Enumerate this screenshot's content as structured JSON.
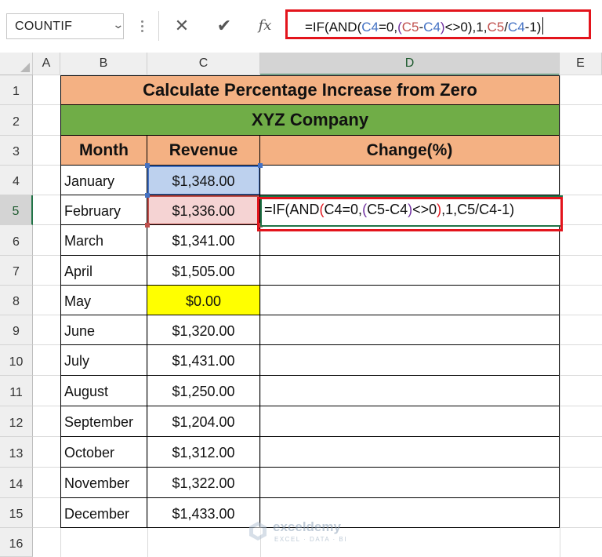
{
  "name_box": {
    "value": "COUNTIF"
  },
  "formula_bar": {
    "cancel_icon": "close-icon",
    "enter_icon": "check-icon",
    "fx_label": "fx",
    "formula_parts": [
      {
        "text": "=IF(AND(",
        "color": "#111111"
      },
      {
        "text": "C4",
        "color": "#4472c4"
      },
      {
        "text": "=0,",
        "color": "#111111"
      },
      {
        "text": "(",
        "color": "#7030a0"
      },
      {
        "text": "C5",
        "color": "#c0504d"
      },
      {
        "text": "-",
        "color": "#111111"
      },
      {
        "text": "C4",
        "color": "#4472c4"
      },
      {
        "text": ")",
        "color": "#7030a0"
      },
      {
        "text": "<>0),1,",
        "color": "#111111"
      },
      {
        "text": "C5",
        "color": "#c0504d"
      },
      {
        "text": "/",
        "color": "#111111"
      },
      {
        "text": "C4",
        "color": "#4472c4"
      },
      {
        "text": "-1)",
        "color": "#111111"
      }
    ]
  },
  "columns": [
    "A",
    "B",
    "C",
    "D",
    "E"
  ],
  "rows": [
    "1",
    "2",
    "3",
    "4",
    "5",
    "6",
    "7",
    "8",
    "9",
    "10",
    "11",
    "12",
    "13",
    "14",
    "15",
    "16"
  ],
  "selected_column": "D",
  "selected_row": "5",
  "sheet": {
    "title": "Calculate Percentage Increase from Zero",
    "company": "XYZ Company",
    "headers": {
      "month": "Month",
      "revenue": "Revenue",
      "change": "Change(%)"
    },
    "data": [
      {
        "month": "January",
        "revenue": "$1,348.00"
      },
      {
        "month": "February",
        "revenue": "$1,336.00"
      },
      {
        "month": "March",
        "revenue": "$1,341.00"
      },
      {
        "month": "April",
        "revenue": "$1,505.00"
      },
      {
        "month": "May",
        "revenue": "$0.00"
      },
      {
        "month": "June",
        "revenue": "$1,320.00"
      },
      {
        "month": "July",
        "revenue": "$1,431.00"
      },
      {
        "month": "August",
        "revenue": "$1,250.00"
      },
      {
        "month": "September",
        "revenue": "$1,204.00"
      },
      {
        "month": "October",
        "revenue": "$1,312.00"
      },
      {
        "month": "November",
        "revenue": "$1,322.00"
      },
      {
        "month": "December",
        "revenue": "$1,433.00"
      }
    ]
  },
  "edit_cell_parts": [
    {
      "text": "=IF(AND",
      "color": "#111111"
    },
    {
      "text": "(",
      "color": "#e3141c"
    },
    {
      "text": "C4=0,",
      "color": "#111111"
    },
    {
      "text": "(",
      "color": "#7030a0"
    },
    {
      "text": "C5-C4",
      "color": "#111111"
    },
    {
      "text": ")",
      "color": "#7030a0"
    },
    {
      "text": "<>0",
      "color": "#111111"
    },
    {
      "text": ")",
      "color": "#e3141c"
    },
    {
      "text": ",1,C5/C4-1)",
      "color": "#111111"
    }
  ],
  "colors": {
    "title_fill": "#f4b183",
    "company_fill": "#70ad47",
    "highlight_may": "#ffff00",
    "ref_c4": "#4472c4",
    "ref_c5": "#c0504d",
    "outline_red": "#e3141c",
    "excel_green": "#217346"
  },
  "watermark": {
    "name": "exceldemy",
    "tagline": "EXCEL · DATA · BI"
  }
}
